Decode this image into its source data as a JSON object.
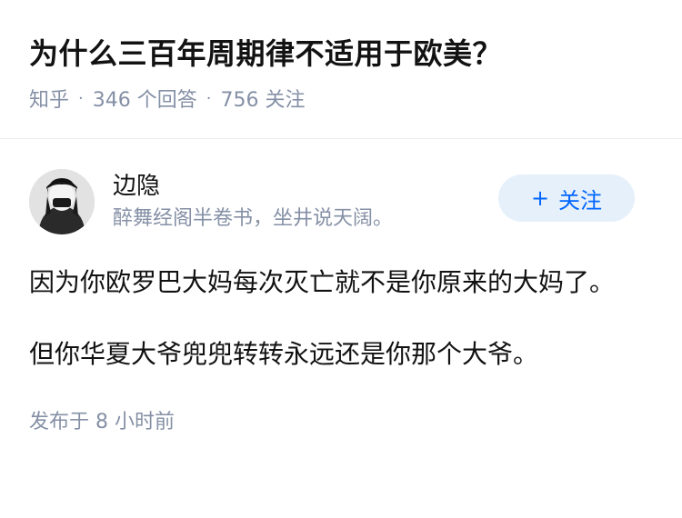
{
  "question": {
    "title": "为什么三百年周期律不适用于欧美？",
    "source": "知乎",
    "answer_count": "346 个回答",
    "follow_count": "756 关注"
  },
  "answer": {
    "author": {
      "name": "边隐",
      "bio": "醉舞经阁半卷书，坐井说天阔。",
      "avatar_icon": "avatar-icon"
    },
    "follow_button": {
      "plus": "+",
      "label": "关注"
    },
    "paragraphs": [
      "因为你欧罗巴大妈每次灭亡就不是你原来的大妈了。",
      "但你华夏大爷兜兜转转永远还是你那个大爷。"
    ],
    "published": "发布于 8 小时前"
  },
  "colors": {
    "accent": "#0066ff",
    "button_bg": "#e6f0fb",
    "meta_gray": "#8590a6",
    "text": "#121212"
  }
}
